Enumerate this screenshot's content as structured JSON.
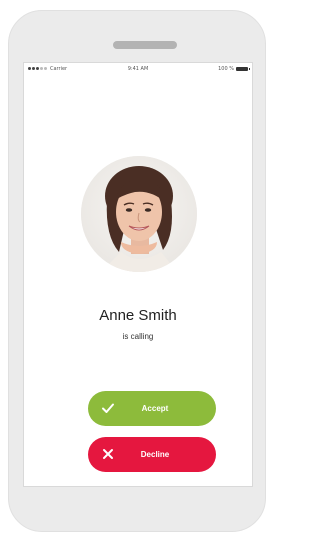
{
  "status_bar": {
    "carrier": "Carrier",
    "time": "9:41 AM",
    "battery": "100 %"
  },
  "caller": {
    "name": "Anne Smith",
    "status": "is calling"
  },
  "actions": {
    "accept_label": "Accept",
    "decline_label": "Decline"
  },
  "colors": {
    "accept": "#8dbb3b",
    "decline": "#e5173f"
  },
  "icons": {
    "accept": "checkmark-icon",
    "decline": "close-icon"
  }
}
